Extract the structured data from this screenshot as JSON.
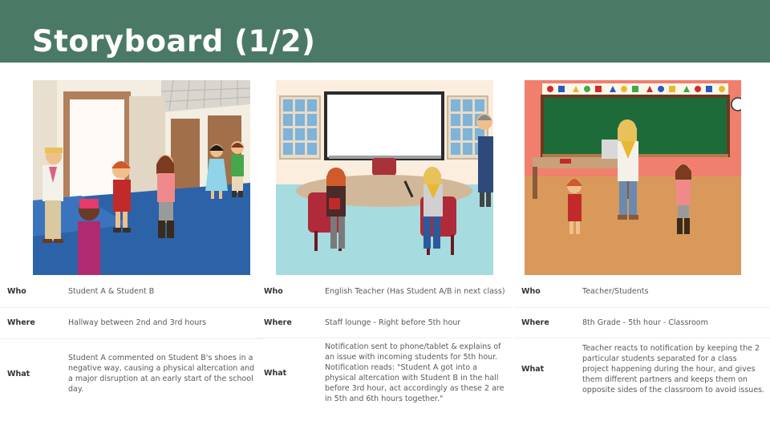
{
  "slide": {
    "title": "Storyboard (1/2)"
  },
  "accent": "#4a7a66",
  "panels": [
    {
      "name": "hallway-scene"
    },
    {
      "name": "staff-lounge-scene"
    },
    {
      "name": "classroom-scene"
    }
  ],
  "tables": [
    {
      "who_label": "Who",
      "who": "Student A & Student B",
      "where_label": "Where",
      "where": "Hallway between 2nd and 3rd hours",
      "what_label": "What",
      "what": "Student A commented on Student B's shoes in a negative way, causing a physical altercation and a major disruption at an early start of the school day."
    },
    {
      "who_label": "Who",
      "who": "English Teacher (Has Student A/B in next class)",
      "where_label": "Where",
      "where": "Staff lounge - Right before 5th hour",
      "what_label": "What",
      "what": "Notification sent to phone/tablet & explains of an issue with incoming students for 5th hour. Notification reads: \"Student A got into a physical altercation with Student B in the hall before 3rd hour, act accordingly as these 2 are in 5th and 6th hours together.\""
    },
    {
      "who_label": "Who",
      "who": "Teacher/Students",
      "where_label": "Where",
      "where": "8th Grade - 5th hour - Classroom",
      "what_label": "What",
      "what": "Teacher reacts to notification by keeping the 2 particular students separated for a class project happening during the hour, and gives them different partners and keeps them on opposite sides of the classroom to avoid issues."
    }
  ]
}
